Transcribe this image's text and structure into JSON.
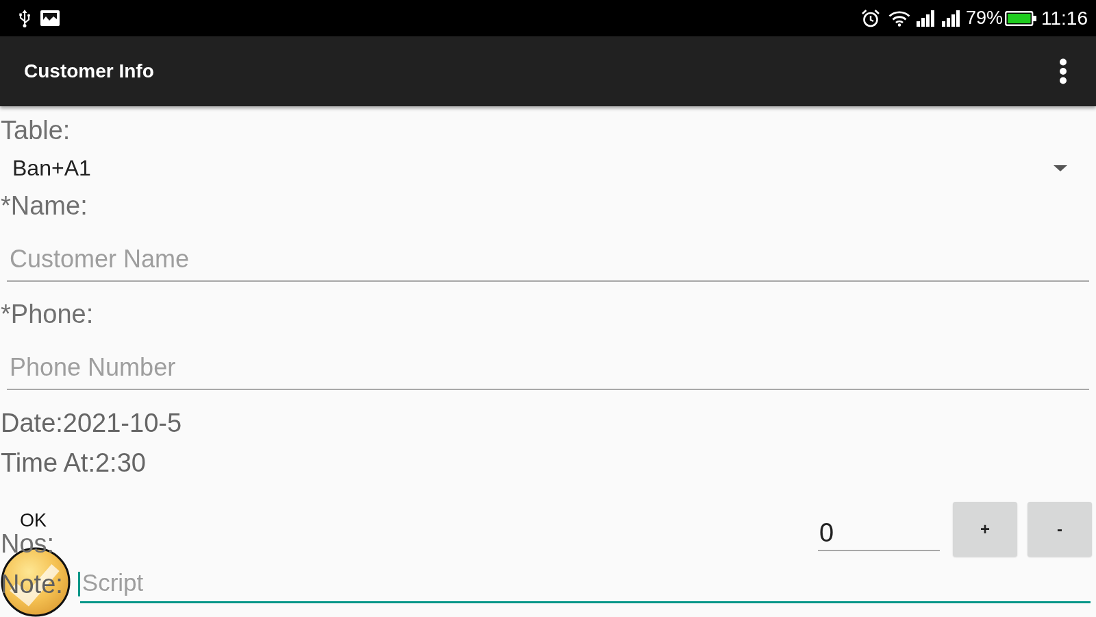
{
  "status_bar": {
    "battery_text": "79%",
    "time": "11:16"
  },
  "app_bar": {
    "title": "Customer Info"
  },
  "form": [
    {
      "kind": "label",
      "text": "Table:"
    },
    {
      "kind": "dropdown",
      "value": "Ban+A1"
    },
    {
      "kind": "label",
      "text": "*Name:"
    },
    {
      "kind": "input",
      "placeholder": "Customer Name",
      "focused": false
    },
    {
      "kind": "label",
      "text": "*Phone:"
    },
    {
      "kind": "input",
      "placeholder": "Phone Number",
      "focused": false
    },
    {
      "kind": "info",
      "text": "Date:2021-10-5"
    },
    {
      "kind": "info",
      "text": "Time At:2:30"
    },
    {
      "kind": "counter",
      "label": "Nos:",
      "value": "0",
      "focused": false,
      "buttons": [
        "+",
        "-"
      ]
    },
    {
      "kind": "note",
      "label": "Note:",
      "placeholder": "Script",
      "focused": true
    }
  ],
  "overlay": {
    "label": "OK"
  }
}
